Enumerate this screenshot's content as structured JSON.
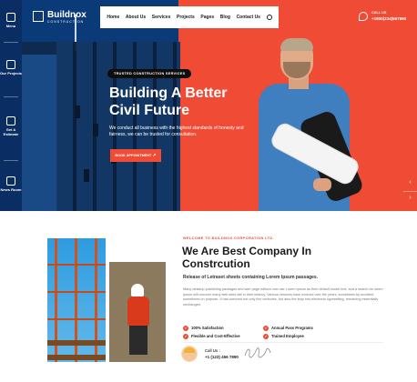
{
  "brand": {
    "name": "Buildnox",
    "tagline": "CONSTRUCTION"
  },
  "nav": {
    "items": [
      "Home",
      "About Us",
      "Services",
      "Projects",
      "Pages",
      "Blog",
      "Contact Us"
    ]
  },
  "header_call": {
    "label": "CALL US",
    "number": "+1800(234)567890"
  },
  "sidebar": {
    "items": [
      {
        "label": "Menu",
        "icon": "menu-icon"
      },
      {
        "label": "Our Projects",
        "icon": "projects-icon"
      },
      {
        "label": "Get A Estimate",
        "icon": "estimate-icon"
      },
      {
        "label": "News Room",
        "icon": "news-icon"
      }
    ]
  },
  "hero": {
    "tag": "TRUSTED CONSTRUCTION SERVICES",
    "title_line1": "Building A Better",
    "title_line2": "Civil Future",
    "description": "We conduct all business with the highest standards of honesty and fairness, we can be trusted for consultation.",
    "cta_label": "BOOK APPOINTMENT",
    "prev_arrow": "‹",
    "next_arrow": "›"
  },
  "about": {
    "eyebrow": "WELCOME TO BUILDNOX CORPORATION LTD.",
    "title_line1": "We Are Best Company In",
    "title_line2": "Constrcution",
    "subtitle": "Release of Letraset sheets containing Lorem Ipsum passages.",
    "body": "Many desktop publishing packages and web page editors now use Lorem Ipsum as their default model text, and a search for lorem ipsum will uncover many web sites still in their infancy. Various versions have evolved over the years, sometimes by accident, sometimes on purpose. It has survived not only five centuries, but also the leap into electronic typesetting, remaining essentially unchanged.",
    "features": [
      "100% Satisfaction",
      "Annual Pass Programs",
      "Flexible and Cost-Effective",
      "Trained Employee"
    ],
    "call_label": "Call Us :",
    "call_number": "+1 (123) 456 7890"
  },
  "colors": {
    "accent": "#ef4b35",
    "navy": "#0b3a78",
    "dark": "#1a1a1a"
  }
}
